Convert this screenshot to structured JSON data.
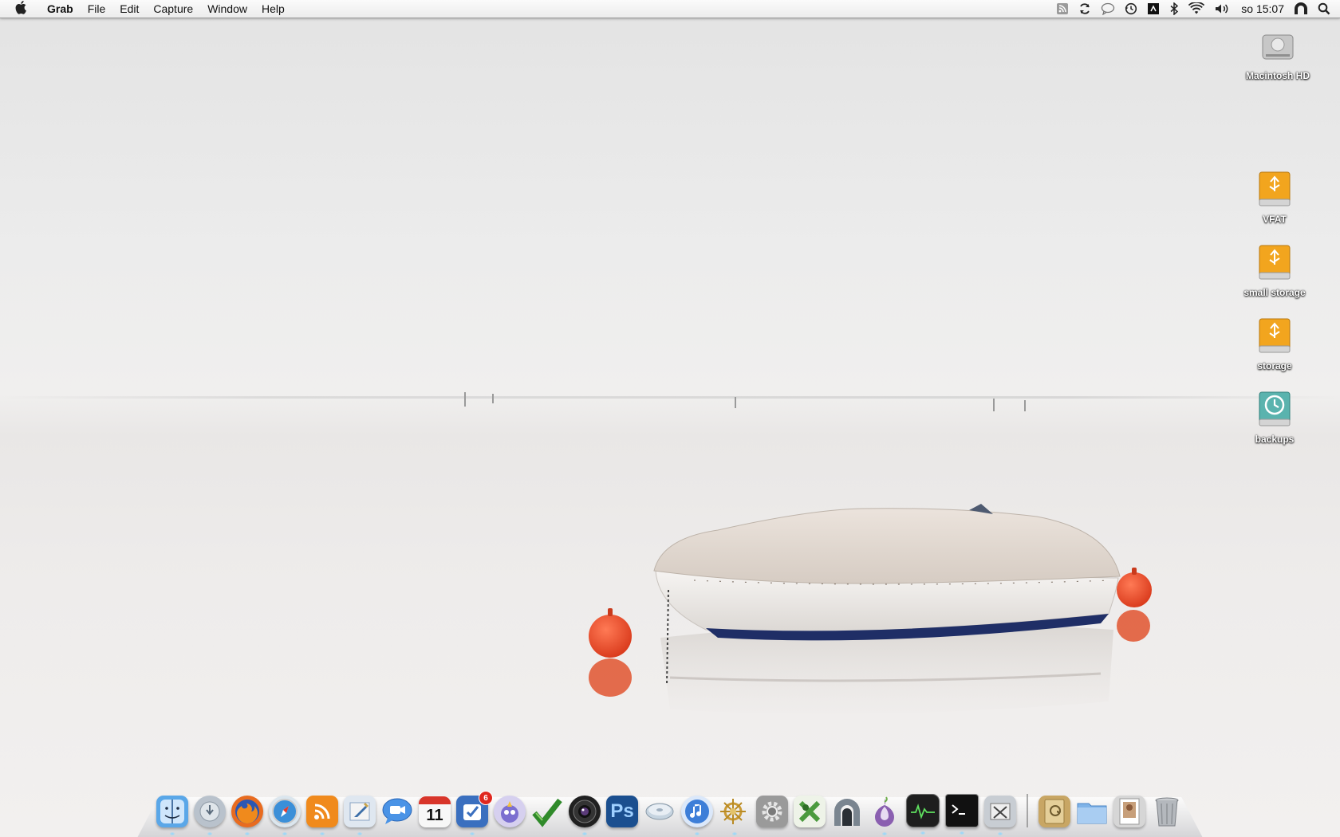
{
  "menubar": {
    "apple_icon": "apple-logo-icon",
    "app_name": "Grab",
    "menus": [
      "File",
      "Edit",
      "Capture",
      "Window",
      "Help"
    ],
    "status_icons": [
      "rss-icon",
      "sync-icon",
      "chat-bubble-icon",
      "time-machine-icon",
      "scripts-icon",
      "bluetooth-icon",
      "wifi-icon",
      "volume-icon"
    ],
    "clock": "so 15:07",
    "user_icon": "vpn-tunnel-icon",
    "spotlight_icon": "spotlight-search-icon"
  },
  "desktop_icons": [
    {
      "label": "Macintosh HD",
      "icon": "hard-drive-icon"
    },
    {
      "label": "VFAT",
      "icon": "usb-drive-icon"
    },
    {
      "label": "small storage",
      "icon": "usb-drive-icon"
    },
    {
      "label": "storage",
      "icon": "usb-drive-icon"
    },
    {
      "label": "backups",
      "icon": "time-machine-drive-icon"
    }
  ],
  "dock": {
    "items": [
      {
        "name": "finder-icon",
        "color": "#5aa7e8"
      },
      {
        "name": "system-update-icon",
        "color": "#b9c2cc"
      },
      {
        "name": "firefox-icon",
        "color": "#e86b1f"
      },
      {
        "name": "safari-icon",
        "color": "#3a8fd8"
      },
      {
        "name": "rss-reader-icon",
        "color": "#f08a1c"
      },
      {
        "name": "mail-icon",
        "color": "#8aa3c4"
      },
      {
        "name": "ichat-icon",
        "color": "#3b87e0"
      },
      {
        "name": "ical-icon",
        "color": "#f2f2f2",
        "text": "11"
      },
      {
        "name": "things-icon",
        "color": "#3a6fbf",
        "badge": "6"
      },
      {
        "name": "adium-icon",
        "color": "#7c6fd0"
      },
      {
        "name": "check-icon",
        "color": "#5aa13a"
      },
      {
        "name": "aperture-icon",
        "color": "#202020"
      },
      {
        "name": "photoshop-icon",
        "color": "#1b4f8f",
        "text": "Ps"
      },
      {
        "name": "disk-utility-icon",
        "color": "#c6d4e0"
      },
      {
        "name": "itunes-icon",
        "color": "#3d7ed8"
      },
      {
        "name": "cog-icon",
        "color": "#d5b45a"
      },
      {
        "name": "system-preferences-icon",
        "color": "#8c8c8c"
      },
      {
        "name": "keepassx-icon",
        "color": "#4b9a3e"
      },
      {
        "name": "vpn-tunnel-icon",
        "color": "#6f7b85"
      },
      {
        "name": "tor-browser-icon",
        "color": "#8a5fb0"
      },
      {
        "name": "activity-monitor-icon",
        "color": "#1e1e1e"
      },
      {
        "name": "terminal-icon",
        "color": "#111111"
      },
      {
        "name": "grab-icon",
        "color": "#b8bec6"
      }
    ],
    "stacks": [
      {
        "name": "address-book-icon",
        "color": "#c8a664"
      },
      {
        "name": "folder-icon",
        "color": "#7fb3e8"
      },
      {
        "name": "preview-icon",
        "color": "#c9c9c9"
      },
      {
        "name": "trash-icon",
        "color": "#8e9297"
      }
    ]
  }
}
